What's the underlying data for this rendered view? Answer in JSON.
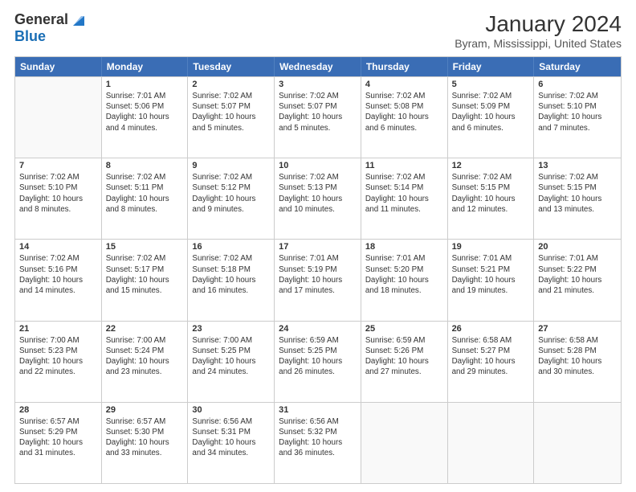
{
  "logo": {
    "general": "General",
    "blue": "Blue"
  },
  "title": "January 2024",
  "location": "Byram, Mississippi, United States",
  "headers": [
    "Sunday",
    "Monday",
    "Tuesday",
    "Wednesday",
    "Thursday",
    "Friday",
    "Saturday"
  ],
  "weeks": [
    [
      {
        "day": "",
        "info": ""
      },
      {
        "day": "1",
        "info": "Sunrise: 7:01 AM\nSunset: 5:06 PM\nDaylight: 10 hours\nand 4 minutes."
      },
      {
        "day": "2",
        "info": "Sunrise: 7:02 AM\nSunset: 5:07 PM\nDaylight: 10 hours\nand 5 minutes."
      },
      {
        "day": "3",
        "info": "Sunrise: 7:02 AM\nSunset: 5:07 PM\nDaylight: 10 hours\nand 5 minutes."
      },
      {
        "day": "4",
        "info": "Sunrise: 7:02 AM\nSunset: 5:08 PM\nDaylight: 10 hours\nand 6 minutes."
      },
      {
        "day": "5",
        "info": "Sunrise: 7:02 AM\nSunset: 5:09 PM\nDaylight: 10 hours\nand 6 minutes."
      },
      {
        "day": "6",
        "info": "Sunrise: 7:02 AM\nSunset: 5:10 PM\nDaylight: 10 hours\nand 7 minutes."
      }
    ],
    [
      {
        "day": "7",
        "info": "Sunrise: 7:02 AM\nSunset: 5:10 PM\nDaylight: 10 hours\nand 8 minutes."
      },
      {
        "day": "8",
        "info": "Sunrise: 7:02 AM\nSunset: 5:11 PM\nDaylight: 10 hours\nand 8 minutes."
      },
      {
        "day": "9",
        "info": "Sunrise: 7:02 AM\nSunset: 5:12 PM\nDaylight: 10 hours\nand 9 minutes."
      },
      {
        "day": "10",
        "info": "Sunrise: 7:02 AM\nSunset: 5:13 PM\nDaylight: 10 hours\nand 10 minutes."
      },
      {
        "day": "11",
        "info": "Sunrise: 7:02 AM\nSunset: 5:14 PM\nDaylight: 10 hours\nand 11 minutes."
      },
      {
        "day": "12",
        "info": "Sunrise: 7:02 AM\nSunset: 5:15 PM\nDaylight: 10 hours\nand 12 minutes."
      },
      {
        "day": "13",
        "info": "Sunrise: 7:02 AM\nSunset: 5:15 PM\nDaylight: 10 hours\nand 13 minutes."
      }
    ],
    [
      {
        "day": "14",
        "info": "Sunrise: 7:02 AM\nSunset: 5:16 PM\nDaylight: 10 hours\nand 14 minutes."
      },
      {
        "day": "15",
        "info": "Sunrise: 7:02 AM\nSunset: 5:17 PM\nDaylight: 10 hours\nand 15 minutes."
      },
      {
        "day": "16",
        "info": "Sunrise: 7:02 AM\nSunset: 5:18 PM\nDaylight: 10 hours\nand 16 minutes."
      },
      {
        "day": "17",
        "info": "Sunrise: 7:01 AM\nSunset: 5:19 PM\nDaylight: 10 hours\nand 17 minutes."
      },
      {
        "day": "18",
        "info": "Sunrise: 7:01 AM\nSunset: 5:20 PM\nDaylight: 10 hours\nand 18 minutes."
      },
      {
        "day": "19",
        "info": "Sunrise: 7:01 AM\nSunset: 5:21 PM\nDaylight: 10 hours\nand 19 minutes."
      },
      {
        "day": "20",
        "info": "Sunrise: 7:01 AM\nSunset: 5:22 PM\nDaylight: 10 hours\nand 21 minutes."
      }
    ],
    [
      {
        "day": "21",
        "info": "Sunrise: 7:00 AM\nSunset: 5:23 PM\nDaylight: 10 hours\nand 22 minutes."
      },
      {
        "day": "22",
        "info": "Sunrise: 7:00 AM\nSunset: 5:24 PM\nDaylight: 10 hours\nand 23 minutes."
      },
      {
        "day": "23",
        "info": "Sunrise: 7:00 AM\nSunset: 5:25 PM\nDaylight: 10 hours\nand 24 minutes."
      },
      {
        "day": "24",
        "info": "Sunrise: 6:59 AM\nSunset: 5:25 PM\nDaylight: 10 hours\nand 26 minutes."
      },
      {
        "day": "25",
        "info": "Sunrise: 6:59 AM\nSunset: 5:26 PM\nDaylight: 10 hours\nand 27 minutes."
      },
      {
        "day": "26",
        "info": "Sunrise: 6:58 AM\nSunset: 5:27 PM\nDaylight: 10 hours\nand 29 minutes."
      },
      {
        "day": "27",
        "info": "Sunrise: 6:58 AM\nSunset: 5:28 PM\nDaylight: 10 hours\nand 30 minutes."
      }
    ],
    [
      {
        "day": "28",
        "info": "Sunrise: 6:57 AM\nSunset: 5:29 PM\nDaylight: 10 hours\nand 31 minutes."
      },
      {
        "day": "29",
        "info": "Sunrise: 6:57 AM\nSunset: 5:30 PM\nDaylight: 10 hours\nand 33 minutes."
      },
      {
        "day": "30",
        "info": "Sunrise: 6:56 AM\nSunset: 5:31 PM\nDaylight: 10 hours\nand 34 minutes."
      },
      {
        "day": "31",
        "info": "Sunrise: 6:56 AM\nSunset: 5:32 PM\nDaylight: 10 hours\nand 36 minutes."
      },
      {
        "day": "",
        "info": ""
      },
      {
        "day": "",
        "info": ""
      },
      {
        "day": "",
        "info": ""
      }
    ]
  ]
}
